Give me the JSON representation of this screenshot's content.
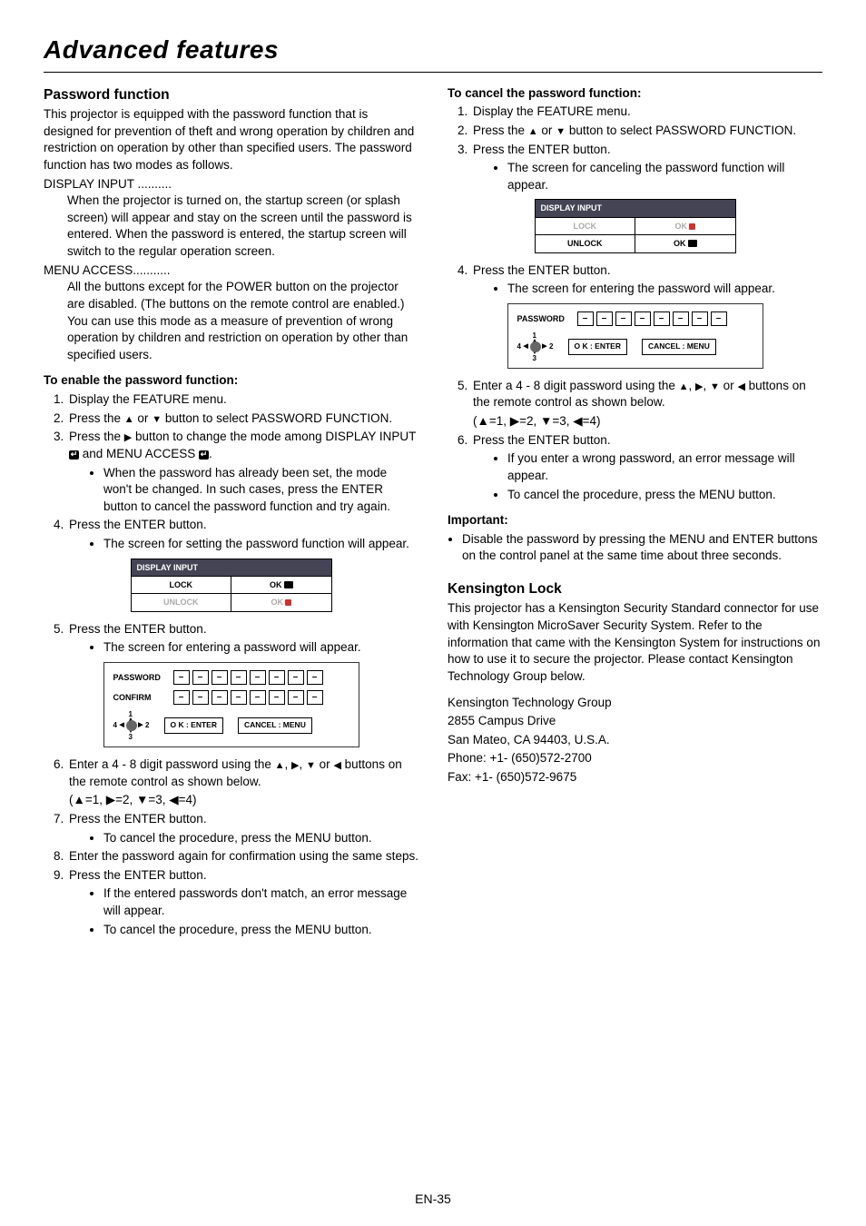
{
  "page": {
    "title": "Advanced features",
    "number": "EN-35"
  },
  "glyph": {
    "up": "▲",
    "down": "▼",
    "left": "◀",
    "right": "▶",
    "dot": "•",
    "dash": "–"
  },
  "left": {
    "h_pw": "Password function",
    "intro": "This projector is equipped with the password function that is designed for prevention of theft and wrong operation by children and restriction on operation by other than specified users. The password function has two modes as follows.",
    "di_lead": "DISPLAY INPUT ..........",
    "di_body": "When the projector is turned on, the startup screen (or splash screen) will appear and stay on the screen until the password is entered. When the password is entered, the startup screen will switch to the regular operation screen.",
    "ma_lead": "MENU ACCESS...........",
    "ma_body": "All the buttons except for the POWER button on the projector are disabled. (The buttons on the remote control are enabled.) You can use this mode as a measure of prevention of wrong operation by children and restriction on operation by other than specified users.",
    "h_enable": "To enable the password function:",
    "steps_a": {
      "s1": "Display the FEATURE menu.",
      "s2a": "Press the ",
      "s2b": " or ",
      "s2c": " button to select PASSWORD FUNCTION.",
      "s3a": "Press the ",
      "s3b": " button to change the mode among DISPLAY INPUT ",
      "s3c": " and MENU ACCESS ",
      "s3d": ".",
      "s3_b1": "When the password has already been set, the mode won't be changed. In such cases, press the ENTER button to cancel the password function and try again.",
      "s4": "Press the ENTER button.",
      "s4_b1": "The screen for setting the password function will appear.",
      "s5": "Press the ENTER button.",
      "s5_b1": "The screen for entering a password will appear.",
      "s6a": "Enter a 4 - 8 digit password using the ",
      "s6b": ", ",
      "s6c": ", ",
      "s6d": " or ",
      "s6e": " buttons on the remote control as shown below.",
      "s6_map": "(▲=1, ▶=2, ▼=3, ◀=4)",
      "s7": "Press the ENTER button.",
      "s7_b1": "To cancel the procedure, press the MENU button.",
      "s8": "Enter the password again for confirmation using the same steps.",
      "s9": "Press the ENTER button.",
      "s9_b1": "If the entered passwords don't match, an error message will appear.",
      "s9_b2": "To cancel the procedure, press the MENU button."
    },
    "fig1": {
      "hdr": "DISPLAY INPUT",
      "lock": "LOCK",
      "unlock": "UNLOCK",
      "ok": "OK"
    },
    "fig2": {
      "pw": "PASSWORD",
      "cf": "CONFIRM",
      "okenter": "O K : ENTER",
      "cancel": "CANCEL : MENU",
      "d1": "1",
      "d2": "2",
      "d3": "3",
      "d4": "4"
    }
  },
  "right": {
    "h_cancel": "To cancel the password function:",
    "steps_b": {
      "s1": "Display the FEATURE menu.",
      "s2a": "Press the ",
      "s2b": " or ",
      "s2c": " button to select PASSWORD FUNCTION.",
      "s3": "Press the ENTER button.",
      "s3_b1": "The screen for canceling the password function will appear.",
      "s4": "Press the ENTER button.",
      "s4_b1": "The screen for entering the password will appear.",
      "s5a": "Enter a 4 - 8 digit password using the ",
      "s5b": ", ",
      "s5c": ", ",
      "s5d": " or ",
      "s5e": " buttons on the remote control as shown below.",
      "s5_map": "(▲=1, ▶=2, ▼=3, ◀=4)",
      "s6": "Press the ENTER button.",
      "s6_b1": "If you enter a wrong password, an error message will appear.",
      "s6_b2": "To cancel the procedure, press the MENU button."
    },
    "h_imp": "Important:",
    "imp_b1": "Disable the password by pressing the MENU and ENTER buttons on the control panel at the same time about three seconds.",
    "h_kl": "Kensington Lock",
    "kl_body": "This projector has a Kensington Security Standard connector for use with Kensington MicroSaver Security System. Refer to the information that came with the Kensington System for instructions on how to use it to secure the projector. Please contact Kensington Technology Group below.",
    "addr1": "Kensington Technology Group",
    "addr2": "2855 Campus Drive",
    "addr3": "San Mateo, CA 94403, U.S.A.",
    "addr4": "Phone: +1- (650)572-2700",
    "addr5": "Fax: +1- (650)572-9675",
    "fig3": {
      "hdr": "DISPLAY INPUT",
      "lock": "LOCK",
      "unlock": "UNLOCK",
      "ok": "OK"
    },
    "fig4": {
      "pw": "PASSWORD",
      "okenter": "O K : ENTER",
      "cancel": "CANCEL : MENU",
      "d1": "1",
      "d2": "2",
      "d3": "3",
      "d4": "4"
    }
  }
}
